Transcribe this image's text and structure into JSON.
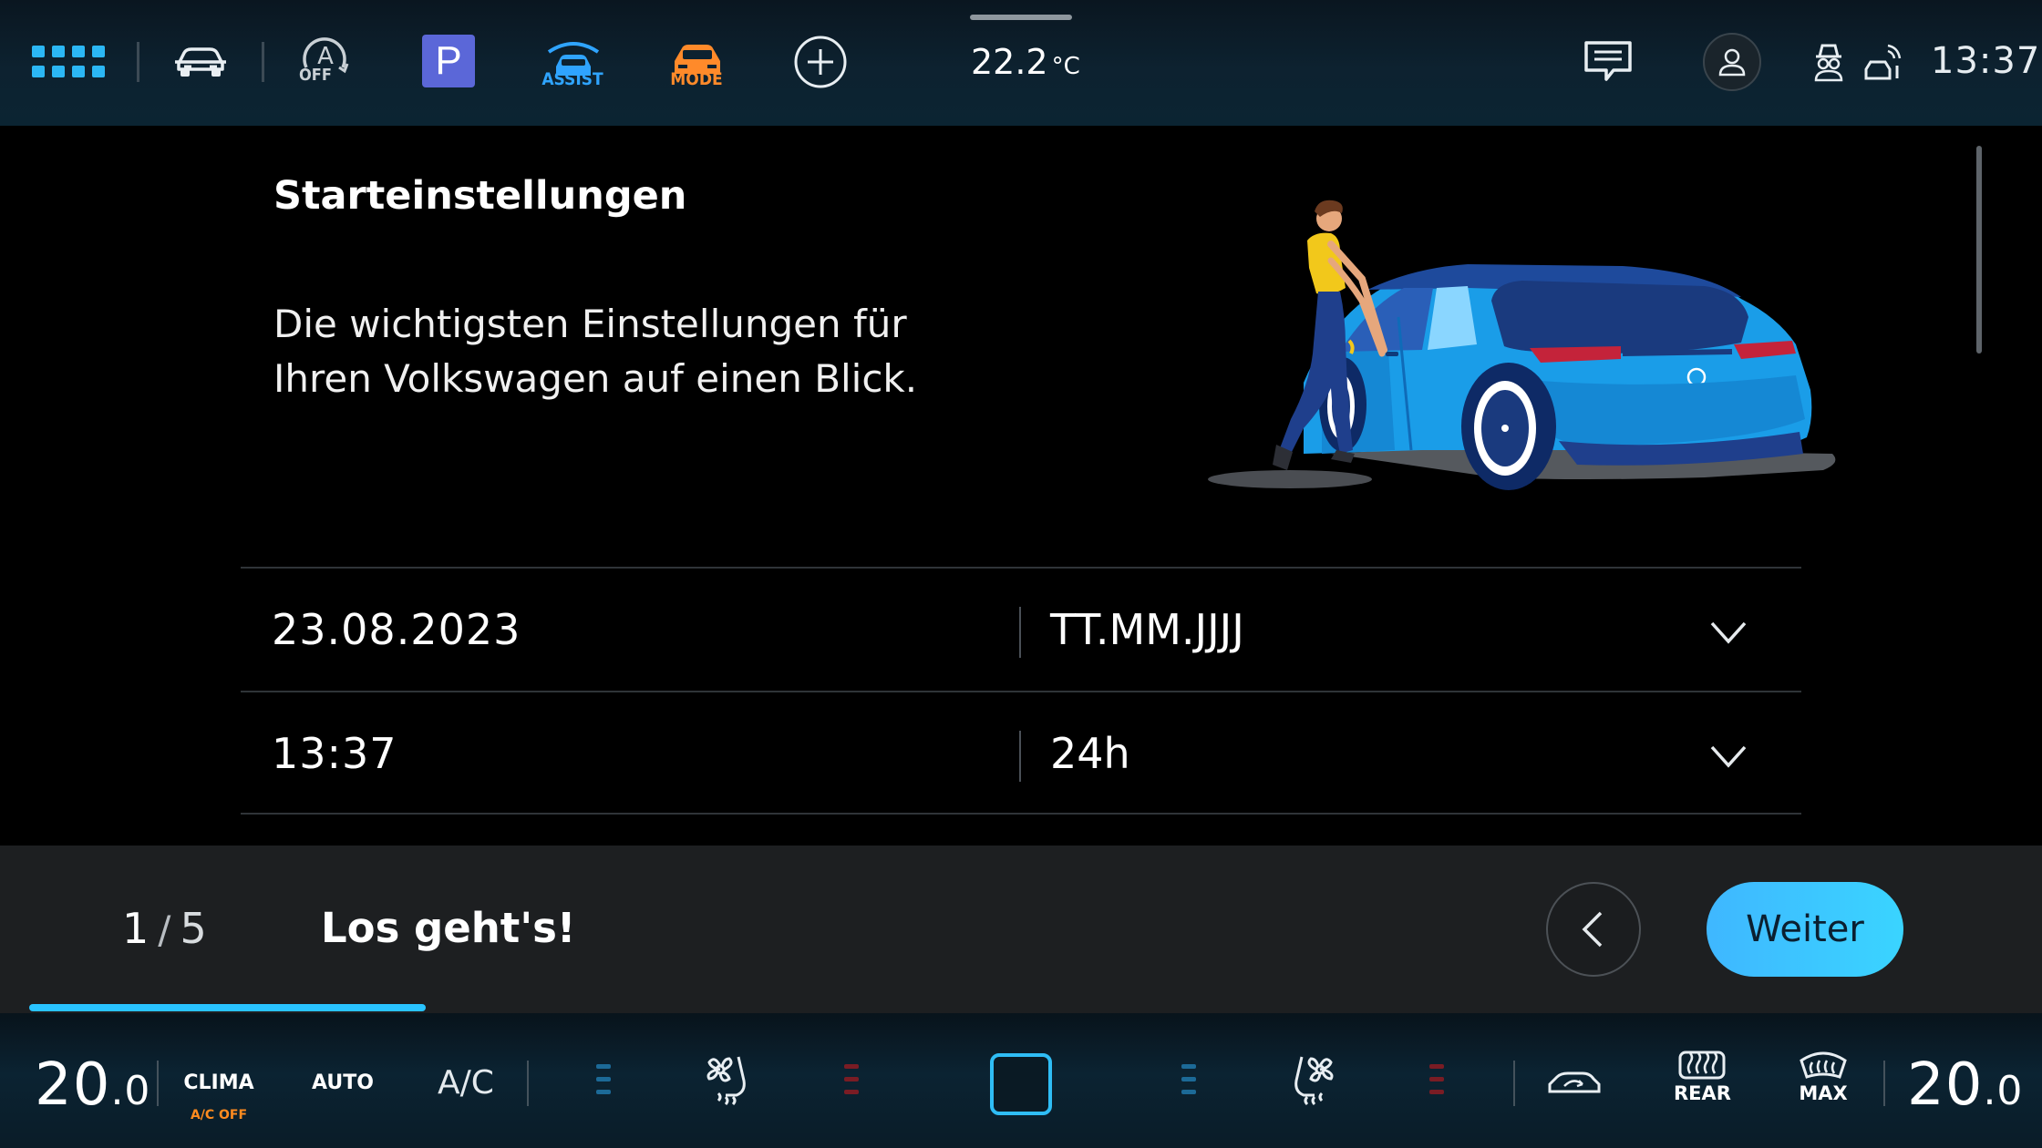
{
  "status_bar": {
    "assist_label": "ASSIST",
    "mode_label": "MODE",
    "auto_hold_label": "OFF",
    "parking_label": "P",
    "outside_temp": "22.2",
    "temp_unit": "°C",
    "clock": "13:37",
    "colors": {
      "assist": "#2fa4ff",
      "mode": "#ff8a2a",
      "parking": "#5b67d8"
    }
  },
  "setup": {
    "title": "Starteinstellungen",
    "description": "Die wichtigsten Einstellungen für Ihren Volkswagen auf einen Blick.",
    "rows": [
      {
        "value": "23.08.2023",
        "format": "TT.MM.JJJJ"
      },
      {
        "value": "13:37",
        "format": "24h"
      }
    ]
  },
  "wizard": {
    "current_step": "1",
    "separator": "/",
    "total_steps": "5",
    "step_title": "Los geht's!",
    "next_label": "Weiter",
    "progress": 0.2,
    "accent": "#29c3ff"
  },
  "climate": {
    "left_temp_int": "20",
    "left_temp_dec": ".0",
    "right_temp_int": "20",
    "right_temp_dec": ".0",
    "clima_label": "CLIMA",
    "ac_off_label": "A/C OFF",
    "auto_label": "AUTO",
    "ac_label": "A/C",
    "rear_label": "REAR",
    "max_label": "MAX"
  }
}
